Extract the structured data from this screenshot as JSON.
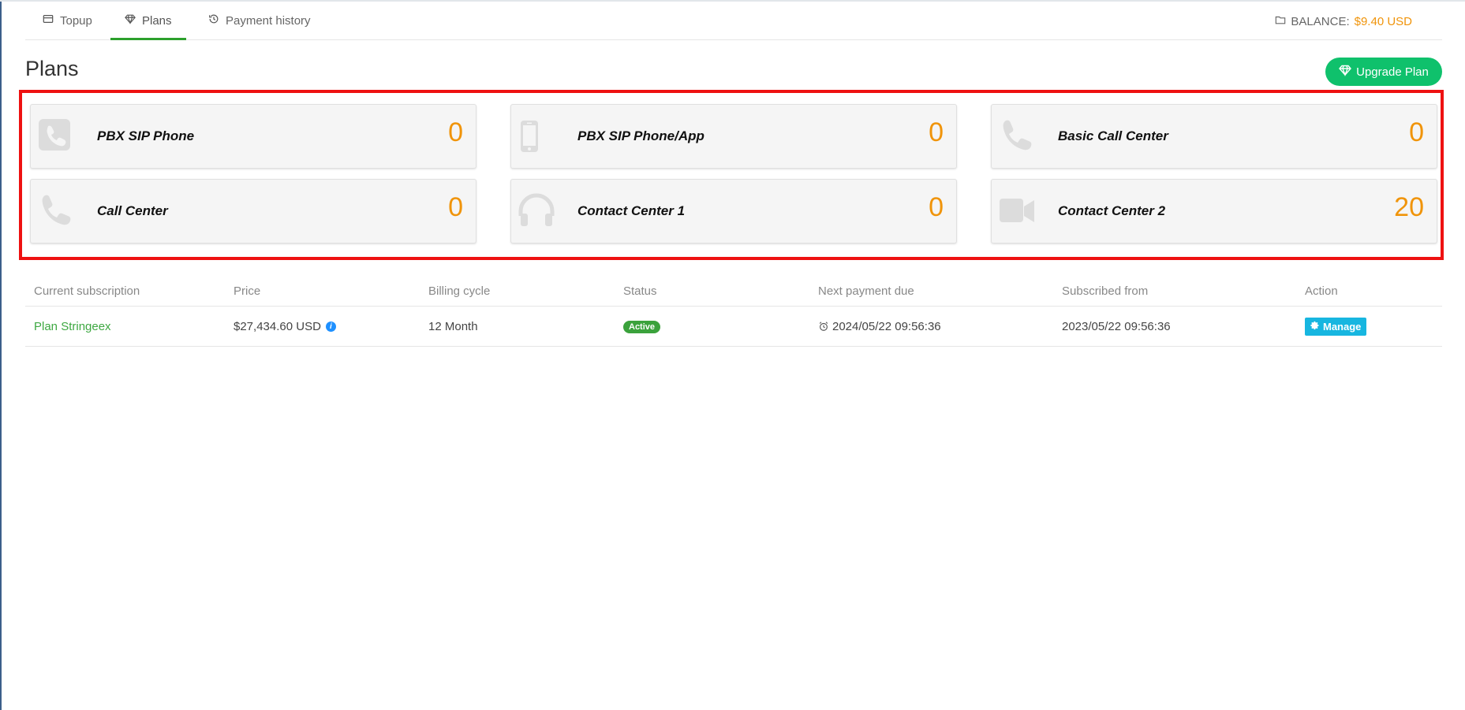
{
  "tabs": [
    {
      "label": "Topup",
      "icon": "card-icon"
    },
    {
      "label": "Plans",
      "icon": "diamond-icon",
      "active": true
    },
    {
      "label": "Payment history",
      "icon": "history-icon"
    }
  ],
  "balance": {
    "label": "BALANCE:",
    "amount": "$9.40 USD",
    "icon": "folder-icon"
  },
  "page_title": "Plans",
  "upgrade_button": {
    "label": "Upgrade Plan",
    "icon": "diamond-icon"
  },
  "plan_cards": [
    {
      "label": "PBX SIP Phone",
      "value": "0",
      "icon": "phone-square-icon"
    },
    {
      "label": "PBX SIP Phone/App",
      "value": "0",
      "icon": "mobile-icon"
    },
    {
      "label": "Basic Call Center",
      "value": "0",
      "icon": "phone-icon"
    },
    {
      "label": "Call Center",
      "value": "0",
      "icon": "phone-icon"
    },
    {
      "label": "Contact Center 1",
      "value": "0",
      "icon": "headphones-icon"
    },
    {
      "label": "Contact Center 2",
      "value": "20",
      "icon": "video-camera-icon"
    }
  ],
  "subscription_table": {
    "headers": [
      "Current subscription",
      "Price",
      "Billing cycle",
      "Status",
      "Next payment due",
      "Subscribed from",
      "Action"
    ],
    "row": {
      "plan": "Plan Stringeex",
      "price": "$27,434.60 USD",
      "billing_cycle": "12 Month",
      "status": "Active",
      "next_payment_due": "2024/05/22 09:56:36",
      "subscribed_from": "2023/05/22 09:56:36",
      "action": "Manage"
    }
  },
  "colors": {
    "accent_green": "#0fc16c",
    "orange_value": "#f0940a",
    "active_tab_underline": "#2ca02c",
    "highlight_frame": "#ee1111",
    "manage_button": "#17b6e0",
    "status_active": "#3ba23c"
  }
}
